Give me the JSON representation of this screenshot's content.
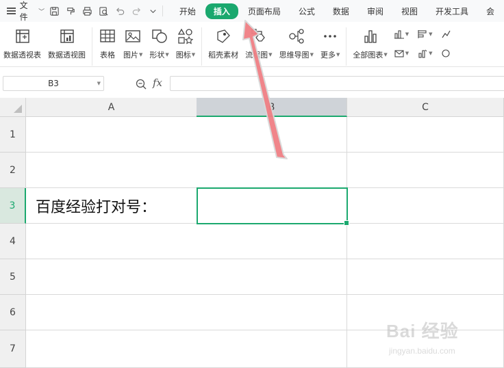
{
  "menubar": {
    "file_label": "文件",
    "tabs": [
      {
        "label": "开始",
        "active": false
      },
      {
        "label": "插入",
        "active": true
      },
      {
        "label": "页面布局",
        "active": false
      },
      {
        "label": "公式",
        "active": false
      },
      {
        "label": "数据",
        "active": false
      },
      {
        "label": "审阅",
        "active": false
      },
      {
        "label": "视图",
        "active": false
      },
      {
        "label": "开发工具",
        "active": false
      },
      {
        "label": "会",
        "active": false
      }
    ],
    "quick_icons": [
      "save-icon",
      "format-painter-icon",
      "print-icon",
      "print-preview-icon",
      "undo-icon",
      "redo-icon",
      "customize-dropdown-icon"
    ]
  },
  "ribbon": {
    "pivot_table": "数据透视表",
    "pivot_chart": "数据透视图",
    "table": "表格",
    "picture": "图片",
    "shape": "形状",
    "icon": "图标",
    "material": "稻壳素材",
    "flowchart": "流程图",
    "mindmap": "思维导图",
    "more": "更多",
    "all_charts": "全部图表"
  },
  "formula_bar": {
    "cell_ref": "B3",
    "fx_label": "fx",
    "formula_value": ""
  },
  "sheet": {
    "columns": [
      "A",
      "B",
      "C"
    ],
    "selected_column": "B",
    "rows": [
      "1",
      "2",
      "3",
      "4",
      "5",
      "6",
      "7"
    ],
    "selected_row": "3",
    "cells": {
      "A3": "百度经验打对号："
    },
    "active_cell": "B3"
  },
  "colors": {
    "accent": "#1aa86e",
    "arrow": "#f07f84"
  },
  "watermark": {
    "logo": "Bai 经验",
    "url": "jingyan.baidu.com"
  }
}
